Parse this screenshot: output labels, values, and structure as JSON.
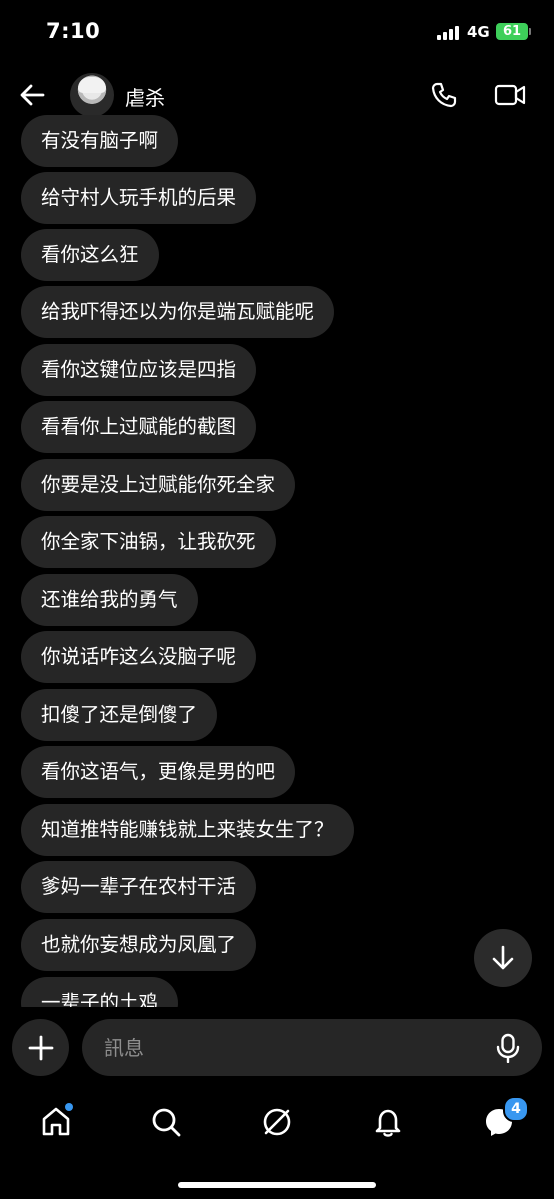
{
  "status_bar": {
    "time": "7:10",
    "network": "4G",
    "battery": "61"
  },
  "header": {
    "contact_name": "虐杀"
  },
  "messages": [
    "有没有脑子啊",
    "给守村人玩手机的后果",
    "看你这么狂",
    "给我吓得还以为你是端瓦赋能呢",
    "看你这键位应该是四指",
    "看看你上过赋能的截图",
    "你要是没上过赋能你死全家",
    "你全家下油锅，让我砍死",
    "还谁给我的勇气",
    "你说话咋这么没脑子呢",
    "扣傻了还是倒傻了",
    "看你这语气，更像是男的吧",
    "知道推特能赚钱就上来装女生了？",
    "爹妈一辈子在农村干活",
    "也就你妄想成为凤凰了",
    "一辈子的土鸡"
  ],
  "composer": {
    "placeholder": "訊息"
  },
  "bottom_nav": {
    "inbox_badge": "4"
  },
  "colors": {
    "background": "#000000",
    "bubble": "#262626",
    "accent": "#3897f0",
    "battery": "#3ecf5a"
  },
  "icons": [
    "back-arrow-icon",
    "phone-icon",
    "video-camera-icon",
    "chevron-down-icon",
    "plus-icon",
    "microphone-icon",
    "home-icon",
    "search-icon",
    "explore-icon",
    "notifications-icon",
    "messenger-icon"
  ]
}
